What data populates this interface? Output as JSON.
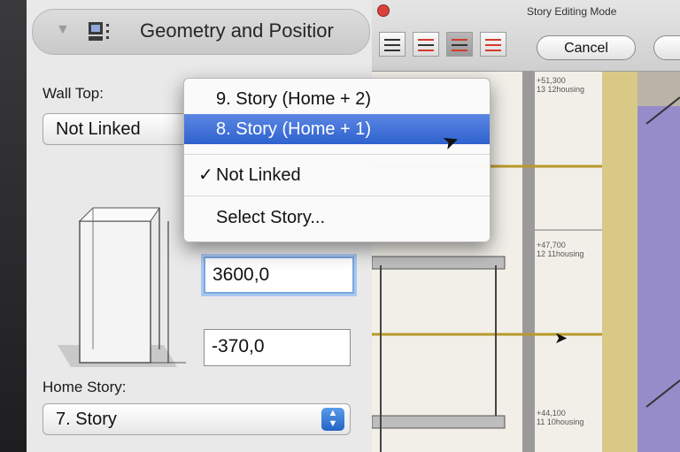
{
  "panel": {
    "title": "Geometry and Positior",
    "wall_top_label": "Wall Top:",
    "wall_top_value": "Not Linked",
    "height_value": "3600,0",
    "offset_value": "-370,0",
    "home_story_label": "Home Story:",
    "home_story_value": "7. Story"
  },
  "dropdown": {
    "items": [
      "9. Story (Home + 2)",
      "8. Story (Home + 1)",
      "Not Linked",
      "Select Story..."
    ],
    "selected_check": "✓",
    "highlighted_index": 1
  },
  "story_window": {
    "title": "Story Editing Mode",
    "cancel_label": "Cancel"
  },
  "plan_labels": {
    "l1a": "+51,300",
    "l1b": "13 12housing",
    "l2a": "+47,700",
    "l2b": "12 11housing",
    "l3a": "+44,100",
    "l3b": "11 10housing"
  },
  "colors": {
    "accent": "#2f62cf",
    "focus": "#7aa7e0",
    "beam": "#b89a2a",
    "wall_purple": "#8b7fd6"
  }
}
